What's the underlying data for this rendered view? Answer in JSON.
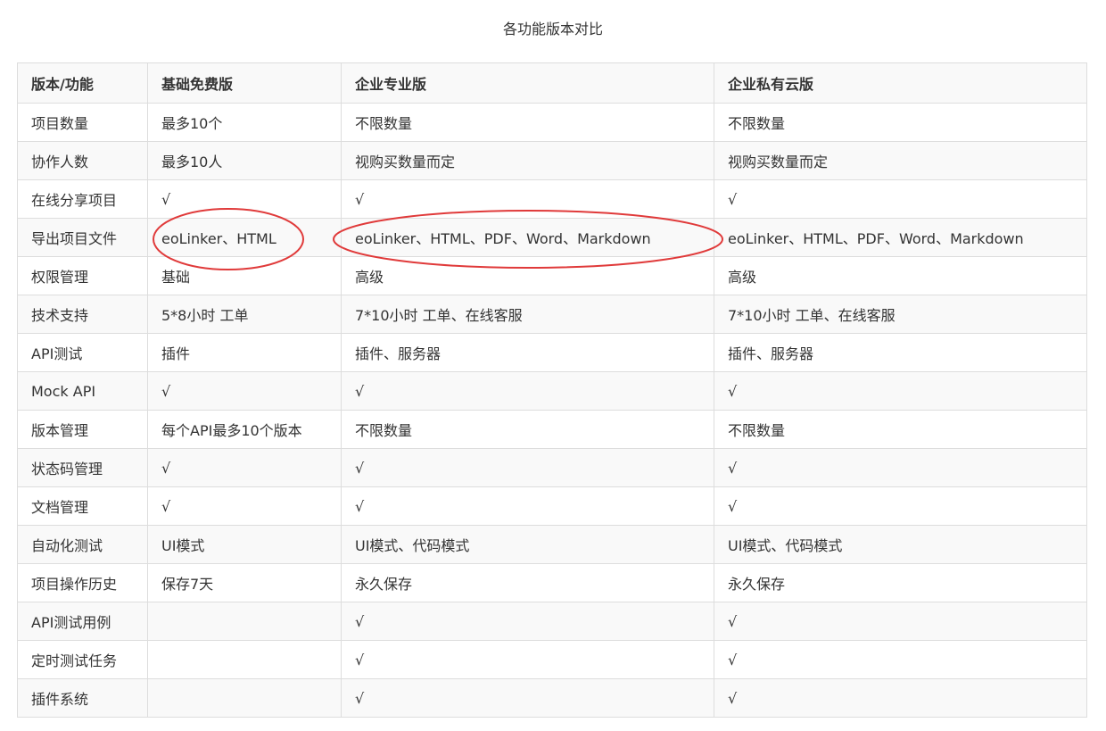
{
  "title": "各功能版本对比",
  "headers": [
    "版本/功能",
    "基础免费版",
    "企业专业版",
    "企业私有云版"
  ],
  "rows": [
    [
      "项目数量",
      "最多10个",
      "不限数量",
      "不限数量"
    ],
    [
      "协作人数",
      "最多10人",
      "视购买数量而定",
      "视购买数量而定"
    ],
    [
      "在线分享项目",
      "√",
      "√",
      "√"
    ],
    [
      "导出项目文件",
      "eoLinker、HTML",
      "eoLinker、HTML、PDF、Word、Markdown",
      "eoLinker、HTML、PDF、Word、Markdown"
    ],
    [
      "权限管理",
      "基础",
      "高级",
      "高级"
    ],
    [
      "技术支持",
      "5*8小时 工单",
      "7*10小时 工单、在线客服",
      "7*10小时 工单、在线客服"
    ],
    [
      "API测试",
      "插件",
      "插件、服务器",
      "插件、服务器"
    ],
    [
      "Mock API",
      "√",
      "√",
      "√"
    ],
    [
      "版本管理",
      "每个API最多10个版本",
      "不限数量",
      "不限数量"
    ],
    [
      "状态码管理",
      "√",
      "√",
      "√"
    ],
    [
      "文档管理",
      "√",
      "√",
      "√"
    ],
    [
      "自动化测试",
      "UI模式",
      "UI模式、代码模式",
      "UI模式、代码模式"
    ],
    [
      "项目操作历史",
      "保存7天",
      "永久保存",
      "永久保存"
    ],
    [
      "API测试用例",
      "",
      "√",
      "√"
    ],
    [
      "定时测试任务",
      "",
      "√",
      "√"
    ],
    [
      "插件系统",
      "",
      "√",
      "√"
    ]
  ],
  "annotation_color": "#e03a3a"
}
